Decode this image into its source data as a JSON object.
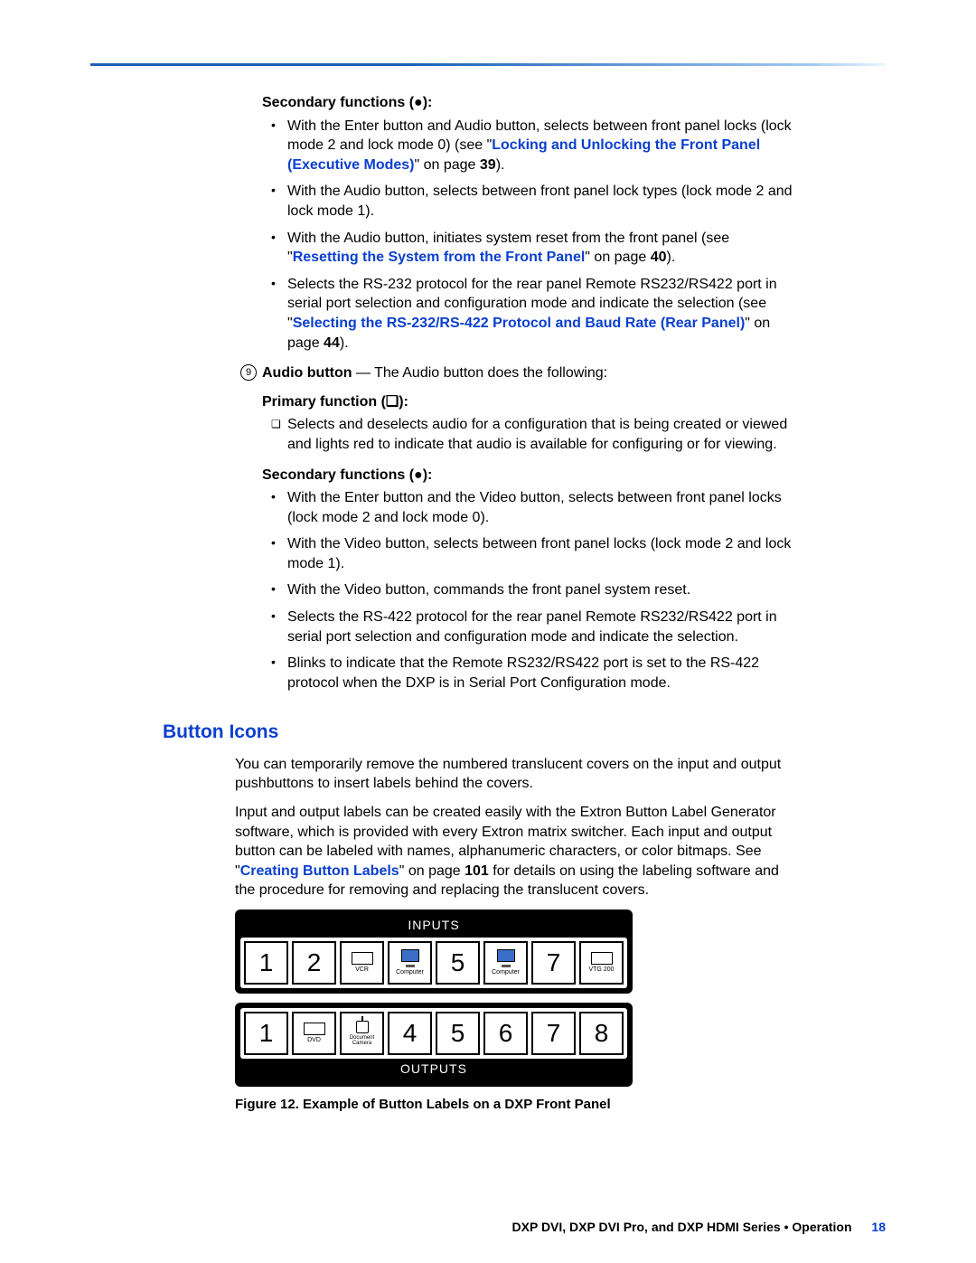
{
  "sec1_head": "Secondary functions (●):",
  "sec1": {
    "b1a": "With the Enter button and Audio button, selects between front panel locks (lock mode 2 and lock mode 0) (see \"",
    "b1link": "Locking and Unlocking the Front Panel (Executive Modes)",
    "b1b": "\" on page ",
    "b1pg": "39",
    "b1c": ").",
    "b2": "With the Audio button, selects between front panel lock types (lock mode 2 and lock mode 1).",
    "b3a": "With the Audio button, initiates system reset from the front panel (see \"",
    "b3link": "Resetting the System from the Front Panel",
    "b3b": "\" on page ",
    "b3pg": "40",
    "b3c": ").",
    "b4a": "Selects the RS-232 protocol for the rear panel Remote RS232/RS422 port in serial port selection and configuration mode and indicate the selection (see \"",
    "b4link": "Selecting the RS-232/RS-422 Protocol and Baud Rate (Rear Panel)",
    "b4b": "\" on page ",
    "b4pg": "44",
    "b4c": ")."
  },
  "callout_num": "9",
  "audio_bold": "Audio button",
  "audio_rest": " — The Audio button does the following:",
  "prim_head": "Primary function (❏):",
  "prim_b1": "Selects and deselects audio for a configuration that is being created or viewed and lights red to indicate that audio is available for configuring or for viewing.",
  "sec2_head": "Secondary functions (●):",
  "sec2": {
    "b1": "With the Enter button and the Video button, selects between front panel locks (lock mode 2 and lock mode 0).",
    "b2": "With the Video button, selects between front panel locks (lock mode 2 and lock mode 1).",
    "b3": "With the Video button, commands the front panel system reset.",
    "b4": "Selects the RS-422 protocol for the rear panel Remote RS232/RS422 port in serial port selection and configuration mode and indicate the selection.",
    "b5": "Blinks to indicate that the Remote RS232/RS422 port is set to the RS-422 protocol when the DXP is in Serial Port Configuration mode."
  },
  "h2": "Button Icons",
  "p1": "You can temporarily remove the numbered translucent covers on the input and output pushbuttons to insert labels behind the covers.",
  "p2a": "Input and output labels can be created easily with the Extron Button Label Generator software, which is provided with every Extron matrix switcher. Each input and output button can be labeled with names, alphanumeric characters, or color bitmaps. See \"",
  "p2link": "Creating Button Labels",
  "p2b": "\" on page ",
  "p2pg": "101",
  "p2c": " for details on using the labeling software and the procedure for removing and replacing the translucent covers.",
  "panel": {
    "inputs_label": "INPUTS",
    "outputs_label": "OUTPUTS",
    "inputs": [
      "1",
      "2",
      "VCR",
      "Computer",
      "5",
      "Computer",
      "7",
      "VTG 200"
    ],
    "outputs": [
      "1",
      "DVD",
      "Document Camera",
      "4",
      "5",
      "6",
      "7",
      "8"
    ]
  },
  "fig_caption": "Figure 12.   Example of Button Labels on a DXP Front Panel",
  "footer_text": "DXP DVI, DXP DVI Pro, and DXP HDMI Series • Operation",
  "footer_page": "18"
}
